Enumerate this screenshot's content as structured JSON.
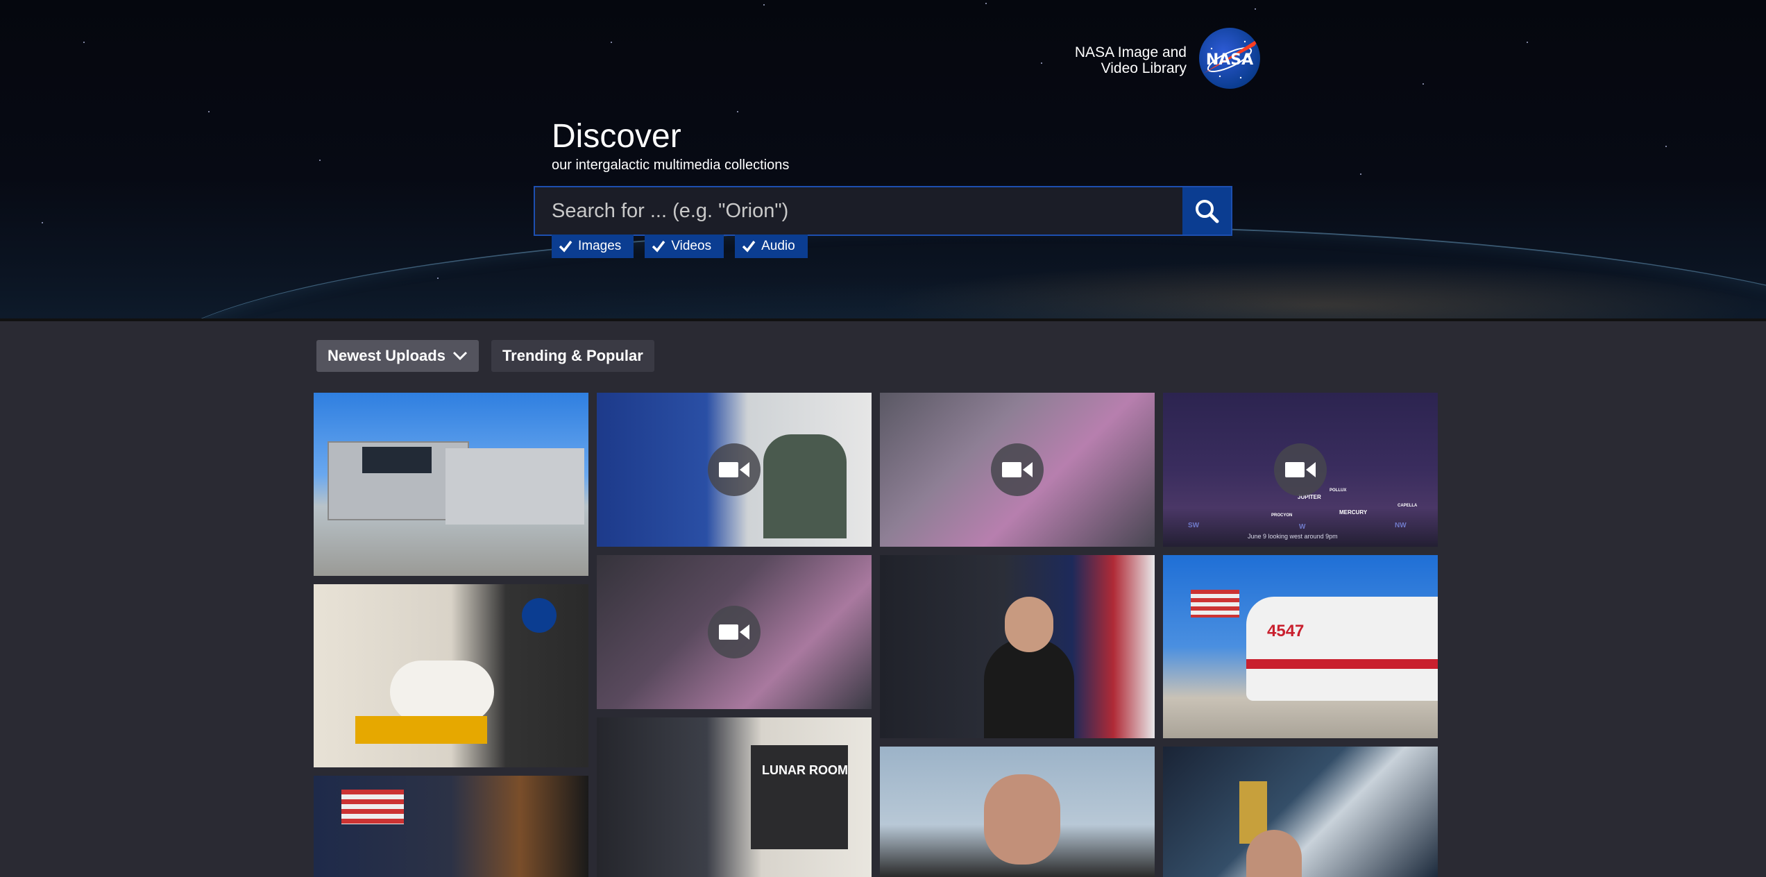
{
  "brand": {
    "line1": "NASA Image and",
    "line2": "Video Library",
    "logo_text": "NASA"
  },
  "hero": {
    "title": "Discover",
    "subtitle": "our intergalactic multimedia collections"
  },
  "search": {
    "placeholder": "Search for ... (e.g. \"Orion\")",
    "value": ""
  },
  "filters": [
    {
      "label": "Images",
      "checked": true
    },
    {
      "label": "Videos",
      "checked": true
    },
    {
      "label": "Audio",
      "checked": true
    }
  ],
  "tabs": [
    {
      "label": "Newest Uploads",
      "active": true
    },
    {
      "label": "Trending & Popular",
      "active": false
    }
  ],
  "tiles": {
    "t1": {
      "kind": "image"
    },
    "t2": {
      "kind": "video"
    },
    "t3": {
      "kind": "video"
    },
    "t4": {
      "kind": "video",
      "caption": "June 9 looking west around 9pm",
      "labels": [
        "JUPITER",
        "MERCURY",
        "POLLUX",
        "CAPELLA",
        "PROCYON",
        "SW",
        "W",
        "NW"
      ]
    },
    "t5": {
      "kind": "image"
    },
    "t6": {
      "kind": "video"
    },
    "t7": {
      "kind": "image"
    },
    "t8": {
      "kind": "image",
      "number": "4547"
    },
    "t9": {
      "kind": "image"
    },
    "t10": {
      "kind": "image",
      "sign": "LUNAR ROOM"
    },
    "t11": {
      "kind": "image"
    },
    "t12": {
      "kind": "image"
    }
  },
  "colors": {
    "nasa_blue": "#0b3d91",
    "background": "#2a2a33",
    "active_tab": "#54545e"
  }
}
